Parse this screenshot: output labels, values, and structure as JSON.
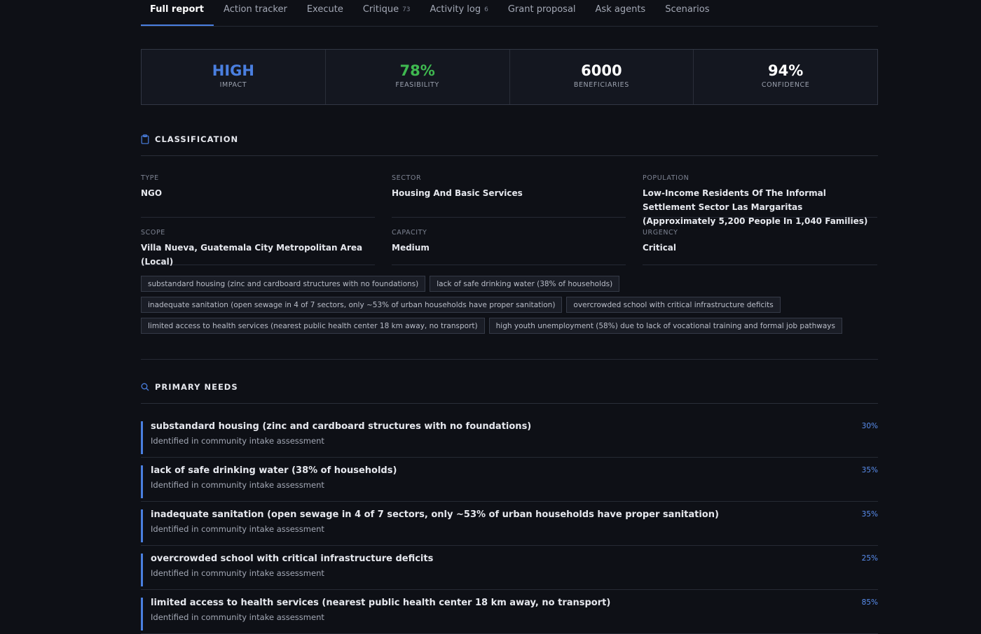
{
  "tabs": [
    {
      "label": "Full report",
      "count": ""
    },
    {
      "label": "Action tracker",
      "count": ""
    },
    {
      "label": "Execute",
      "count": ""
    },
    {
      "label": "Critique",
      "count": "73"
    },
    {
      "label": "Activity log",
      "count": "6"
    },
    {
      "label": "Grant proposal",
      "count": ""
    },
    {
      "label": "Ask agents",
      "count": ""
    },
    {
      "label": "Scenarios",
      "count": ""
    }
  ],
  "stats": [
    {
      "value": "HIGH",
      "label": "IMPACT",
      "color": "#4a7fe0"
    },
    {
      "value": "78%",
      "label": "FEASIBILITY",
      "color": "#3fb950"
    },
    {
      "value": "6000",
      "label": "BENEFICIARIES",
      "color": "#ffffff"
    },
    {
      "value": "94%",
      "label": "CONFIDENCE",
      "color": "#ffffff"
    }
  ],
  "classification": {
    "title": "CLASSIFICATION",
    "fields": [
      {
        "key": "TYPE",
        "value": "NGO"
      },
      {
        "key": "SECTOR",
        "value": "Housing And Basic Services"
      },
      {
        "key": "POPULATION",
        "value": "Low-Income Residents Of The Informal Settlement Sector Las Margaritas (Approximately 5,200 People In 1,040 Families)"
      },
      {
        "key": "SCOPE",
        "value": "Villa Nueva, Guatemala City Metropolitan Area (Local)"
      },
      {
        "key": "CAPACITY",
        "value": "Medium"
      },
      {
        "key": "URGENCY",
        "value": "Critical"
      }
    ],
    "tags": [
      "substandard housing (zinc and cardboard structures with no foundations)",
      "lack of safe drinking water (38% of households)",
      "inadequate sanitation (open sewage in 4 of 7 sectors, only ~53% of urban households have proper sanitation)",
      "overcrowded school with critical infrastructure deficits",
      "limited access to health services (nearest public health center 18 km away, no transport)",
      "high youth unemployment (58%) due to lack of vocational training and formal job pathways"
    ]
  },
  "needs": {
    "title": "PRIMARY NEEDS",
    "items": [
      {
        "title": "substandard housing (zinc and cardboard structures with no foundations)",
        "sub": "Identified in community intake assessment",
        "pct": "30%"
      },
      {
        "title": "lack of safe drinking water (38% of households)",
        "sub": "Identified in community intake assessment",
        "pct": "35%"
      },
      {
        "title": "inadequate sanitation (open sewage in 4 of 7 sectors, only ~53% of urban households have proper sanitation)",
        "sub": "Identified in community intake assessment",
        "pct": "35%"
      },
      {
        "title": "overcrowded school with critical infrastructure deficits",
        "sub": "Identified in community intake assessment",
        "pct": "25%"
      },
      {
        "title": "limited access to health services (nearest public health center 18 km away, no transport)",
        "sub": "Identified in community intake assessment",
        "pct": "85%"
      }
    ]
  },
  "icons": {
    "classification": "clipboard-icon",
    "needs": "search-icon"
  },
  "colors": {
    "accent": "#4a7fe0",
    "success": "#3fb950"
  }
}
